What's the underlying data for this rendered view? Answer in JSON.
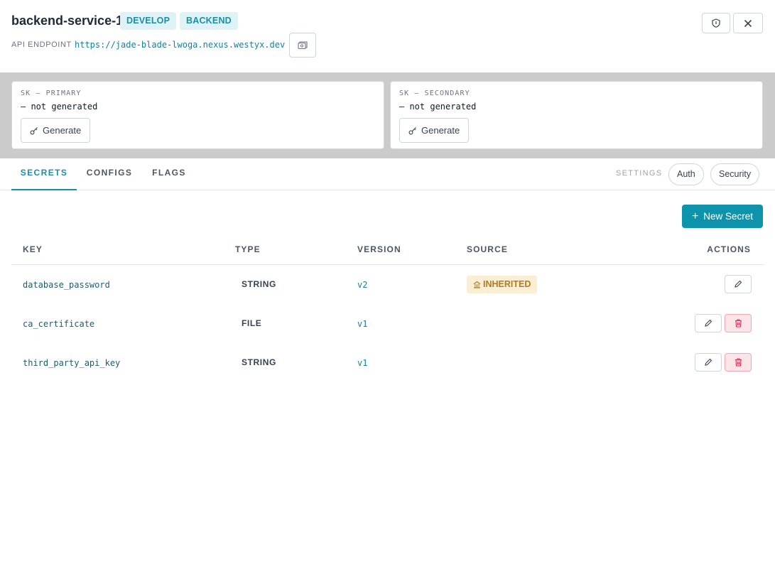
{
  "header": {
    "title": "backend-service-1",
    "tags": [
      "DEVELOP",
      "BACKEND"
    ],
    "endpoint_label": "API ENDPOINT",
    "endpoint_url": "https://jade-blade-lwoga.nexus.westyx.dev"
  },
  "keys": [
    {
      "label": "SK — PRIMARY",
      "value": "— not generated",
      "button": "Generate"
    },
    {
      "label": "SK — SECONDARY",
      "value": "— not generated",
      "button": "Generate"
    }
  ],
  "tabs": [
    "SECRETS",
    "CONFIGS",
    "FLAGS"
  ],
  "active_tab": "SECRETS",
  "settings": {
    "label": "SETTINGS",
    "buttons": [
      "Auth",
      "Security"
    ]
  },
  "new_button": "New Secret",
  "table": {
    "headers": [
      "KEY",
      "TYPE",
      "VERSION",
      "SOURCE",
      "ACTIONS"
    ],
    "rows": [
      {
        "key": "database_password",
        "type": "STRING",
        "version": "v2",
        "source": "INHERITED"
      },
      {
        "key": "ca_certificate",
        "type": "FILE",
        "version": "v1",
        "source": ""
      },
      {
        "key": "third_party_api_key",
        "type": "STRING",
        "version": "v1",
        "source": ""
      }
    ]
  },
  "colors": {
    "accent": "#0e93ad",
    "inherited_bg": "#fbefd3",
    "inherited_fg": "#b7791f",
    "delete_bg": "#fde4e9"
  }
}
